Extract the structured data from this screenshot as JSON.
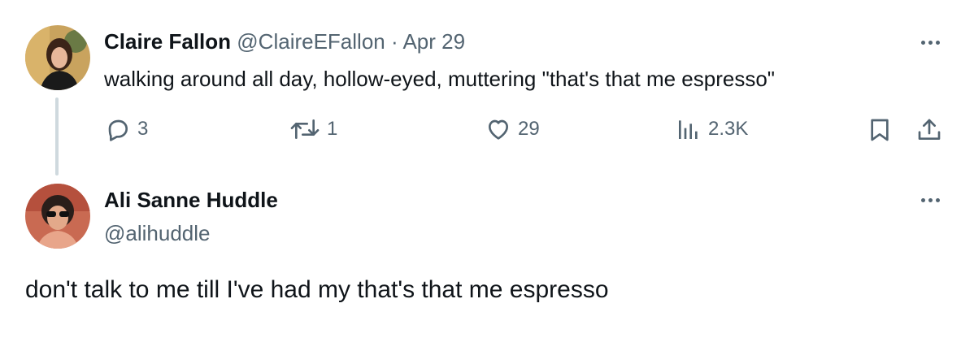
{
  "tweet": {
    "author_name": "Claire Fallon",
    "handle": "@ClaireEFallon",
    "separator": "·",
    "date": "Apr 29",
    "text": "walking around all day, hollow-eyed, muttering \"that's that me espresso\"",
    "actions": {
      "replies": "3",
      "retweets": "1",
      "likes": "29",
      "views": "2.3K"
    }
  },
  "reply": {
    "author_name": "Ali Sanne Huddle",
    "handle": "@alihuddle",
    "text": "don't talk to me till I've had my that's that me espresso"
  },
  "icons": {
    "reply": "reply-icon",
    "retweet": "retweet-icon",
    "like": "heart-icon",
    "views": "views-chart-icon",
    "bookmark": "bookmark-icon",
    "share": "share-icon",
    "more": "more-icon"
  },
  "colors": {
    "text": "#0f1419",
    "muted": "#536471",
    "thread_line": "#cfd9de"
  }
}
